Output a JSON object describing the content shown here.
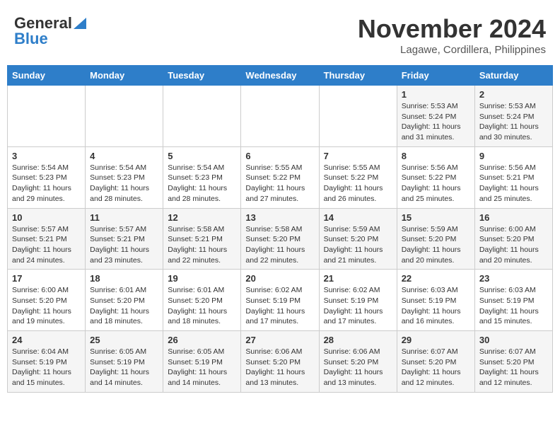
{
  "header": {
    "logo_general": "General",
    "logo_blue": "Blue",
    "month_title": "November 2024",
    "location": "Lagawe, Cordillera, Philippines"
  },
  "weekdays": [
    "Sunday",
    "Monday",
    "Tuesday",
    "Wednesday",
    "Thursday",
    "Friday",
    "Saturday"
  ],
  "weeks": [
    [
      {
        "day": "",
        "sunrise": "",
        "sunset": "",
        "daylight": ""
      },
      {
        "day": "",
        "sunrise": "",
        "sunset": "",
        "daylight": ""
      },
      {
        "day": "",
        "sunrise": "",
        "sunset": "",
        "daylight": ""
      },
      {
        "day": "",
        "sunrise": "",
        "sunset": "",
        "daylight": ""
      },
      {
        "day": "",
        "sunrise": "",
        "sunset": "",
        "daylight": ""
      },
      {
        "day": "1",
        "sunrise": "Sunrise: 5:53 AM",
        "sunset": "Sunset: 5:24 PM",
        "daylight": "Daylight: 11 hours and 31 minutes."
      },
      {
        "day": "2",
        "sunrise": "Sunrise: 5:53 AM",
        "sunset": "Sunset: 5:24 PM",
        "daylight": "Daylight: 11 hours and 30 minutes."
      }
    ],
    [
      {
        "day": "3",
        "sunrise": "Sunrise: 5:54 AM",
        "sunset": "Sunset: 5:23 PM",
        "daylight": "Daylight: 11 hours and 29 minutes."
      },
      {
        "day": "4",
        "sunrise": "Sunrise: 5:54 AM",
        "sunset": "Sunset: 5:23 PM",
        "daylight": "Daylight: 11 hours and 28 minutes."
      },
      {
        "day": "5",
        "sunrise": "Sunrise: 5:54 AM",
        "sunset": "Sunset: 5:23 PM",
        "daylight": "Daylight: 11 hours and 28 minutes."
      },
      {
        "day": "6",
        "sunrise": "Sunrise: 5:55 AM",
        "sunset": "Sunset: 5:22 PM",
        "daylight": "Daylight: 11 hours and 27 minutes."
      },
      {
        "day": "7",
        "sunrise": "Sunrise: 5:55 AM",
        "sunset": "Sunset: 5:22 PM",
        "daylight": "Daylight: 11 hours and 26 minutes."
      },
      {
        "day": "8",
        "sunrise": "Sunrise: 5:56 AM",
        "sunset": "Sunset: 5:22 PM",
        "daylight": "Daylight: 11 hours and 25 minutes."
      },
      {
        "day": "9",
        "sunrise": "Sunrise: 5:56 AM",
        "sunset": "Sunset: 5:21 PM",
        "daylight": "Daylight: 11 hours and 25 minutes."
      }
    ],
    [
      {
        "day": "10",
        "sunrise": "Sunrise: 5:57 AM",
        "sunset": "Sunset: 5:21 PM",
        "daylight": "Daylight: 11 hours and 24 minutes."
      },
      {
        "day": "11",
        "sunrise": "Sunrise: 5:57 AM",
        "sunset": "Sunset: 5:21 PM",
        "daylight": "Daylight: 11 hours and 23 minutes."
      },
      {
        "day": "12",
        "sunrise": "Sunrise: 5:58 AM",
        "sunset": "Sunset: 5:21 PM",
        "daylight": "Daylight: 11 hours and 22 minutes."
      },
      {
        "day": "13",
        "sunrise": "Sunrise: 5:58 AM",
        "sunset": "Sunset: 5:20 PM",
        "daylight": "Daylight: 11 hours and 22 minutes."
      },
      {
        "day": "14",
        "sunrise": "Sunrise: 5:59 AM",
        "sunset": "Sunset: 5:20 PM",
        "daylight": "Daylight: 11 hours and 21 minutes."
      },
      {
        "day": "15",
        "sunrise": "Sunrise: 5:59 AM",
        "sunset": "Sunset: 5:20 PM",
        "daylight": "Daylight: 11 hours and 20 minutes."
      },
      {
        "day": "16",
        "sunrise": "Sunrise: 6:00 AM",
        "sunset": "Sunset: 5:20 PM",
        "daylight": "Daylight: 11 hours and 20 minutes."
      }
    ],
    [
      {
        "day": "17",
        "sunrise": "Sunrise: 6:00 AM",
        "sunset": "Sunset: 5:20 PM",
        "daylight": "Daylight: 11 hours and 19 minutes."
      },
      {
        "day": "18",
        "sunrise": "Sunrise: 6:01 AM",
        "sunset": "Sunset: 5:20 PM",
        "daylight": "Daylight: 11 hours and 18 minutes."
      },
      {
        "day": "19",
        "sunrise": "Sunrise: 6:01 AM",
        "sunset": "Sunset: 5:20 PM",
        "daylight": "Daylight: 11 hours and 18 minutes."
      },
      {
        "day": "20",
        "sunrise": "Sunrise: 6:02 AM",
        "sunset": "Sunset: 5:19 PM",
        "daylight": "Daylight: 11 hours and 17 minutes."
      },
      {
        "day": "21",
        "sunrise": "Sunrise: 6:02 AM",
        "sunset": "Sunset: 5:19 PM",
        "daylight": "Daylight: 11 hours and 17 minutes."
      },
      {
        "day": "22",
        "sunrise": "Sunrise: 6:03 AM",
        "sunset": "Sunset: 5:19 PM",
        "daylight": "Daylight: 11 hours and 16 minutes."
      },
      {
        "day": "23",
        "sunrise": "Sunrise: 6:03 AM",
        "sunset": "Sunset: 5:19 PM",
        "daylight": "Daylight: 11 hours and 15 minutes."
      }
    ],
    [
      {
        "day": "24",
        "sunrise": "Sunrise: 6:04 AM",
        "sunset": "Sunset: 5:19 PM",
        "daylight": "Daylight: 11 hours and 15 minutes."
      },
      {
        "day": "25",
        "sunrise": "Sunrise: 6:05 AM",
        "sunset": "Sunset: 5:19 PM",
        "daylight": "Daylight: 11 hours and 14 minutes."
      },
      {
        "day": "26",
        "sunrise": "Sunrise: 6:05 AM",
        "sunset": "Sunset: 5:19 PM",
        "daylight": "Daylight: 11 hours and 14 minutes."
      },
      {
        "day": "27",
        "sunrise": "Sunrise: 6:06 AM",
        "sunset": "Sunset: 5:20 PM",
        "daylight": "Daylight: 11 hours and 13 minutes."
      },
      {
        "day": "28",
        "sunrise": "Sunrise: 6:06 AM",
        "sunset": "Sunset: 5:20 PM",
        "daylight": "Daylight: 11 hours and 13 minutes."
      },
      {
        "day": "29",
        "sunrise": "Sunrise: 6:07 AM",
        "sunset": "Sunset: 5:20 PM",
        "daylight": "Daylight: 11 hours and 12 minutes."
      },
      {
        "day": "30",
        "sunrise": "Sunrise: 6:07 AM",
        "sunset": "Sunset: 5:20 PM",
        "daylight": "Daylight: 11 hours and 12 minutes."
      }
    ]
  ]
}
